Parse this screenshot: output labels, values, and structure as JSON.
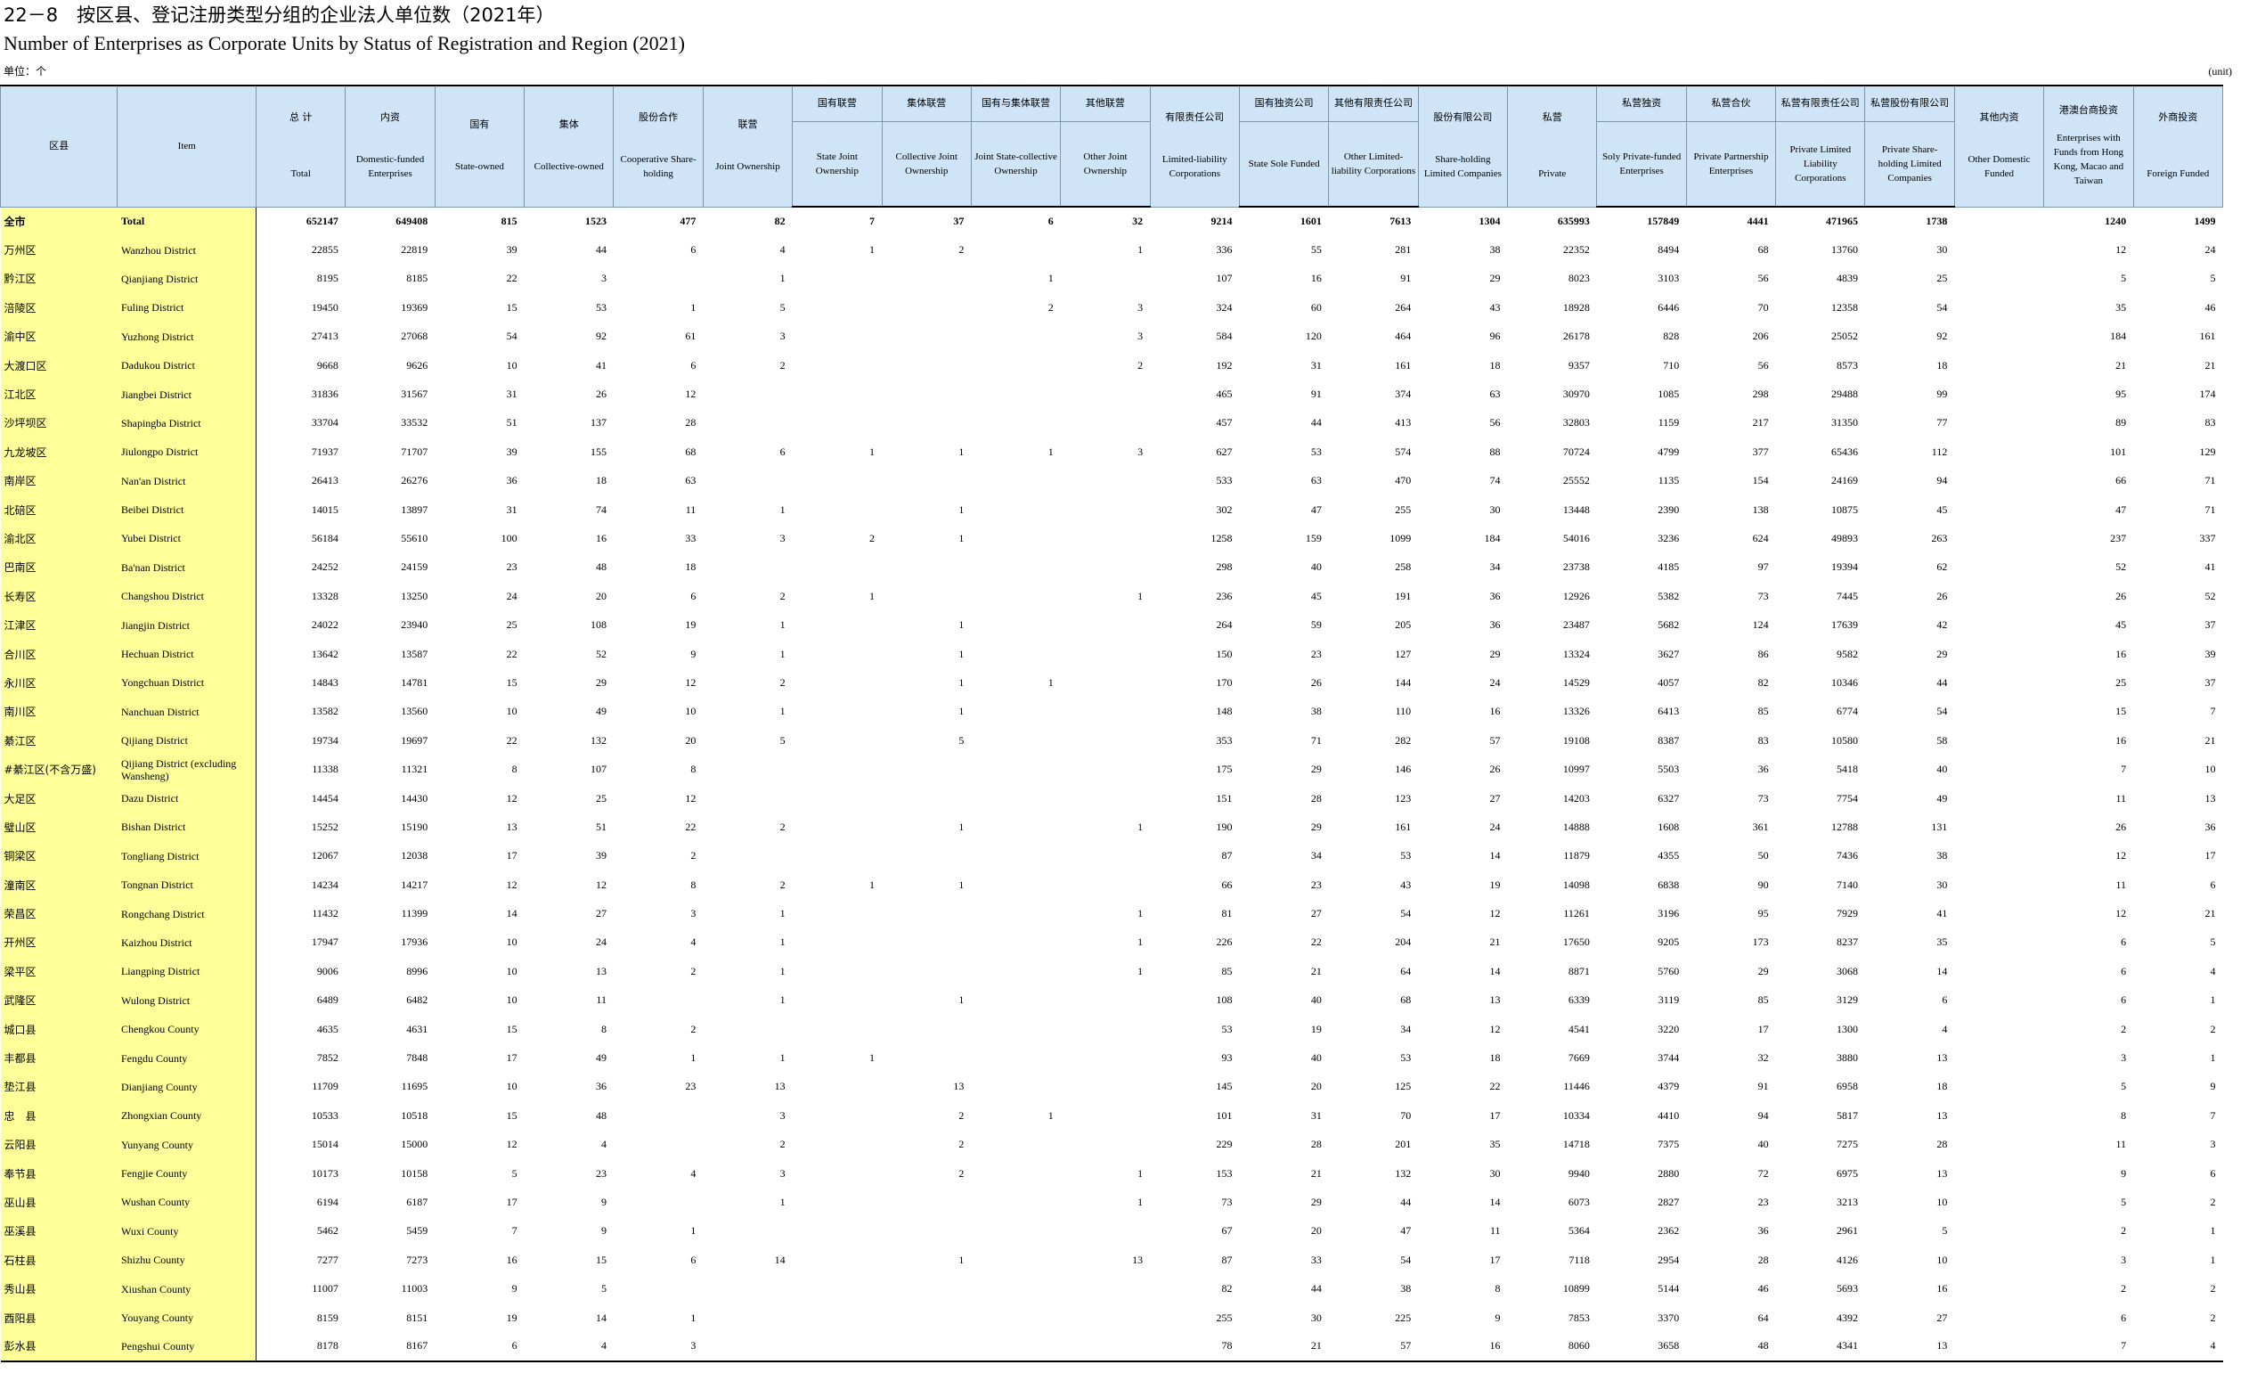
{
  "title_cn": "22－8　按区县、登记注册类型分组的企业法人单位数（2021年）",
  "title_en": "Number of Enterprises as Corporate Units by Status of Registration and Region (2021)",
  "unit_cn": "单位：个",
  "unit_en": "(unit)",
  "header": {
    "region": "区县",
    "item": "Item",
    "total_cn": "总  计",
    "total_en": "Total",
    "domestic_cn": "内资",
    "domestic_en": "Domestic-funded Enterprises",
    "state_cn": "国有",
    "state_en": "State-owned",
    "collective_cn": "集体",
    "collective_en": "Collective-owned",
    "coop_cn": "股份合作",
    "coop_en": "Cooperative Share-holding",
    "joint_cn": "联营",
    "joint_en": "Joint Ownership",
    "state_joint_cn": "国有联营",
    "state_joint_en": "State Joint Ownership",
    "coll_joint_cn": "集体联营",
    "coll_joint_en": "Collective Joint Ownership",
    "sc_joint_cn": "国有与集体联营",
    "sc_joint_en": "Joint State-collective Ownership",
    "other_joint_cn": "其他联营",
    "other_joint_en": "Other Joint Ownership",
    "ltd_cn": "有限责任公司",
    "ltd_en": "Limited-liability Corporations",
    "state_sole_cn": "国有独资公司",
    "state_sole_en": "State Sole Funded",
    "other_ltd_cn": "其他有限责任公司",
    "other_ltd_en": "Other Limited-liability Corporations",
    "share_cn": "股份有限公司",
    "share_en": "Share-holding Limited Companies",
    "private_cn": "私营",
    "private_en": "Private",
    "sole_private_cn": "私营独资",
    "sole_private_en": "Soly Private-funded Enterprises",
    "partner_cn": "私营合伙",
    "partner_en": "Private Partnership Enterprises",
    "private_ltd_cn": "私营有限责任公司",
    "private_ltd_en": "Private Limited Liability Corporations",
    "private_share_cn": "私营股份有限公司",
    "private_share_en": "Private Share-holding Limited Companies",
    "other_dom_cn": "其他内资",
    "other_dom_en": "Other Domestic Funded",
    "hmt_cn": "港澳台商投资",
    "hmt_en": "Enterprises with Funds from Hong Kong, Macao and Taiwan",
    "foreign_cn": "外商投资",
    "foreign_en": "Foreign Funded"
  },
  "rows": [
    {
      "cn": "全市",
      "en": "Total",
      "v": [
        "652147",
        "649408",
        "815",
        "1523",
        "477",
        "82",
        "7",
        "37",
        "6",
        "32",
        "9214",
        "1601",
        "7613",
        "1304",
        "635993",
        "157849",
        "4441",
        "471965",
        "1738",
        "",
        "1240",
        "1499"
      ]
    },
    {
      "cn": "万州区",
      "en": "Wanzhou District",
      "v": [
        "22855",
        "22819",
        "39",
        "44",
        "6",
        "4",
        "1",
        "2",
        "",
        "1",
        "336",
        "55",
        "281",
        "38",
        "22352",
        "8494",
        "68",
        "13760",
        "30",
        "",
        "12",
        "24"
      ]
    },
    {
      "cn": "黔江区",
      "en": "Qianjiang District",
      "v": [
        "8195",
        "8185",
        "22",
        "3",
        "",
        "1",
        "",
        "",
        "1",
        "",
        "107",
        "16",
        "91",
        "29",
        "8023",
        "3103",
        "56",
        "4839",
        "25",
        "",
        "5",
        "5"
      ]
    },
    {
      "cn": "涪陵区",
      "en": "Fuling District",
      "v": [
        "19450",
        "19369",
        "15",
        "53",
        "1",
        "5",
        "",
        "",
        "2",
        "3",
        "324",
        "60",
        "264",
        "43",
        "18928",
        "6446",
        "70",
        "12358",
        "54",
        "",
        "35",
        "46"
      ]
    },
    {
      "cn": "渝中区",
      "en": "Yuzhong District",
      "v": [
        "27413",
        "27068",
        "54",
        "92",
        "61",
        "3",
        "",
        "",
        "",
        "3",
        "584",
        "120",
        "464",
        "96",
        "26178",
        "828",
        "206",
        "25052",
        "92",
        "",
        "184",
        "161"
      ]
    },
    {
      "cn": "大渡口区",
      "en": "Dadukou District",
      "v": [
        "9668",
        "9626",
        "10",
        "41",
        "6",
        "2",
        "",
        "",
        "",
        "2",
        "192",
        "31",
        "161",
        "18",
        "9357",
        "710",
        "56",
        "8573",
        "18",
        "",
        "21",
        "21"
      ]
    },
    {
      "cn": "江北区",
      "en": "Jiangbei District",
      "v": [
        "31836",
        "31567",
        "31",
        "26",
        "12",
        "",
        "",
        "",
        "",
        "",
        "465",
        "91",
        "374",
        "63",
        "30970",
        "1085",
        "298",
        "29488",
        "99",
        "",
        "95",
        "174"
      ]
    },
    {
      "cn": "沙坪坝区",
      "en": "Shapingba District",
      "v": [
        "33704",
        "33532",
        "51",
        "137",
        "28",
        "",
        "",
        "",
        "",
        "",
        "457",
        "44",
        "413",
        "56",
        "32803",
        "1159",
        "217",
        "31350",
        "77",
        "",
        "89",
        "83"
      ]
    },
    {
      "cn": "九龙坡区",
      "en": "Jiulongpo District",
      "v": [
        "71937",
        "71707",
        "39",
        "155",
        "68",
        "6",
        "1",
        "1",
        "1",
        "3",
        "627",
        "53",
        "574",
        "88",
        "70724",
        "4799",
        "377",
        "65436",
        "112",
        "",
        "101",
        "129"
      ]
    },
    {
      "cn": "南岸区",
      "en": "Nan'an District",
      "v": [
        "26413",
        "26276",
        "36",
        "18",
        "63",
        "",
        "",
        "",
        "",
        "",
        "533",
        "63",
        "470",
        "74",
        "25552",
        "1135",
        "154",
        "24169",
        "94",
        "",
        "66",
        "71"
      ]
    },
    {
      "cn": "北碚区",
      "en": "Beibei District",
      "v": [
        "14015",
        "13897",
        "31",
        "74",
        "11",
        "1",
        "",
        "1",
        "",
        "",
        "302",
        "47",
        "255",
        "30",
        "13448",
        "2390",
        "138",
        "10875",
        "45",
        "",
        "47",
        "71"
      ]
    },
    {
      "cn": "渝北区",
      "en": "Yubei District",
      "v": [
        "56184",
        "55610",
        "100",
        "16",
        "33",
        "3",
        "2",
        "1",
        "",
        "",
        "1258",
        "159",
        "1099",
        "184",
        "54016",
        "3236",
        "624",
        "49893",
        "263",
        "",
        "237",
        "337"
      ]
    },
    {
      "cn": "巴南区",
      "en": "Ba'nan District",
      "v": [
        "24252",
        "24159",
        "23",
        "48",
        "18",
        "",
        "",
        "",
        "",
        "",
        "298",
        "40",
        "258",
        "34",
        "23738",
        "4185",
        "97",
        "19394",
        "62",
        "",
        "52",
        "41"
      ]
    },
    {
      "cn": "长寿区",
      "en": "Changshou District",
      "v": [
        "13328",
        "13250",
        "24",
        "20",
        "6",
        "2",
        "1",
        "",
        "",
        "1",
        "236",
        "45",
        "191",
        "36",
        "12926",
        "5382",
        "73",
        "7445",
        "26",
        "",
        "26",
        "52"
      ]
    },
    {
      "cn": "江津区",
      "en": "Jiangjin District",
      "v": [
        "24022",
        "23940",
        "25",
        "108",
        "19",
        "1",
        "",
        "1",
        "",
        "",
        "264",
        "59",
        "205",
        "36",
        "23487",
        "5682",
        "124",
        "17639",
        "42",
        "",
        "45",
        "37"
      ]
    },
    {
      "cn": "合川区",
      "en": "Hechuan District",
      "v": [
        "13642",
        "13587",
        "22",
        "52",
        "9",
        "1",
        "",
        "1",
        "",
        "",
        "150",
        "23",
        "127",
        "29",
        "13324",
        "3627",
        "86",
        "9582",
        "29",
        "",
        "16",
        "39"
      ]
    },
    {
      "cn": "永川区",
      "en": "Yongchuan District",
      "v": [
        "14843",
        "14781",
        "15",
        "29",
        "12",
        "2",
        "",
        "1",
        "1",
        "",
        "170",
        "26",
        "144",
        "24",
        "14529",
        "4057",
        "82",
        "10346",
        "44",
        "",
        "25",
        "37"
      ]
    },
    {
      "cn": "南川区",
      "en": "Nanchuan District",
      "v": [
        "13582",
        "13560",
        "10",
        "49",
        "10",
        "1",
        "",
        "1",
        "",
        "",
        "148",
        "38",
        "110",
        "16",
        "13326",
        "6413",
        "85",
        "6774",
        "54",
        "",
        "15",
        "7"
      ]
    },
    {
      "cn": "綦江区",
      "en": "Qijiang District",
      "v": [
        "19734",
        "19697",
        "22",
        "132",
        "20",
        "5",
        "",
        "5",
        "",
        "",
        "353",
        "71",
        "282",
        "57",
        "19108",
        "8387",
        "83",
        "10580",
        "58",
        "",
        "16",
        "21"
      ]
    },
    {
      "cn": "#綦江区(不含万盛)",
      "en": "Qijiang District (excluding Wansheng)",
      "v": [
        "11338",
        "11321",
        "8",
        "107",
        "8",
        "",
        "",
        "",
        "",
        "",
        "175",
        "29",
        "146",
        "26",
        "10997",
        "5503",
        "36",
        "5418",
        "40",
        "",
        "7",
        "10"
      ]
    },
    {
      "cn": "大足区",
      "en": "Dazu District",
      "v": [
        "14454",
        "14430",
        "12",
        "25",
        "12",
        "",
        "",
        "",
        "",
        "",
        "151",
        "28",
        "123",
        "27",
        "14203",
        "6327",
        "73",
        "7754",
        "49",
        "",
        "11",
        "13"
      ]
    },
    {
      "cn": "璧山区",
      "en": "Bishan District",
      "v": [
        "15252",
        "15190",
        "13",
        "51",
        "22",
        "2",
        "",
        "1",
        "",
        "1",
        "190",
        "29",
        "161",
        "24",
        "14888",
        "1608",
        "361",
        "12788",
        "131",
        "",
        "26",
        "36"
      ]
    },
    {
      "cn": "铜梁区",
      "en": "Tongliang District",
      "v": [
        "12067",
        "12038",
        "17",
        "39",
        "2",
        "",
        "",
        "",
        "",
        "",
        "87",
        "34",
        "53",
        "14",
        "11879",
        "4355",
        "50",
        "7436",
        "38",
        "",
        "12",
        "17"
      ]
    },
    {
      "cn": "潼南区",
      "en": "Tongnan District",
      "v": [
        "14234",
        "14217",
        "12",
        "12",
        "8",
        "2",
        "1",
        "1",
        "",
        "",
        "66",
        "23",
        "43",
        "19",
        "14098",
        "6838",
        "90",
        "7140",
        "30",
        "",
        "11",
        "6"
      ]
    },
    {
      "cn": "荣昌区",
      "en": "Rongchang District",
      "v": [
        "11432",
        "11399",
        "14",
        "27",
        "3",
        "1",
        "",
        "",
        "",
        "1",
        "81",
        "27",
        "54",
        "12",
        "11261",
        "3196",
        "95",
        "7929",
        "41",
        "",
        "12",
        "21"
      ]
    },
    {
      "cn": "开州区",
      "en": "Kaizhou District",
      "v": [
        "17947",
        "17936",
        "10",
        "24",
        "4",
        "1",
        "",
        "",
        "",
        "1",
        "226",
        "22",
        "204",
        "21",
        "17650",
        "9205",
        "173",
        "8237",
        "35",
        "",
        "6",
        "5"
      ]
    },
    {
      "cn": "梁平区",
      "en": "Liangping District",
      "v": [
        "9006",
        "8996",
        "10",
        "13",
        "2",
        "1",
        "",
        "",
        "",
        "1",
        "85",
        "21",
        "64",
        "14",
        "8871",
        "5760",
        "29",
        "3068",
        "14",
        "",
        "6",
        "4"
      ]
    },
    {
      "cn": "武隆区",
      "en": "Wulong District",
      "v": [
        "6489",
        "6482",
        "10",
        "11",
        "",
        "1",
        "",
        "1",
        "",
        "",
        "108",
        "40",
        "68",
        "13",
        "6339",
        "3119",
        "85",
        "3129",
        "6",
        "",
        "6",
        "1"
      ]
    },
    {
      "cn": "城口县",
      "en": "Chengkou County",
      "v": [
        "4635",
        "4631",
        "15",
        "8",
        "2",
        "",
        "",
        "",
        "",
        "",
        "53",
        "19",
        "34",
        "12",
        "4541",
        "3220",
        "17",
        "1300",
        "4",
        "",
        "2",
        "2"
      ]
    },
    {
      "cn": "丰都县",
      "en": "Fengdu County",
      "v": [
        "7852",
        "7848",
        "17",
        "49",
        "1",
        "1",
        "1",
        "",
        "",
        "",
        "93",
        "40",
        "53",
        "18",
        "7669",
        "3744",
        "32",
        "3880",
        "13",
        "",
        "3",
        "1"
      ]
    },
    {
      "cn": "垫江县",
      "en": "Dianjiang County",
      "v": [
        "11709",
        "11695",
        "10",
        "36",
        "23",
        "13",
        "",
        "13",
        "",
        "",
        "145",
        "20",
        "125",
        "22",
        "11446",
        "4379",
        "91",
        "6958",
        "18",
        "",
        "5",
        "9"
      ]
    },
    {
      "cn": "忠　县",
      "en": "Zhongxian County",
      "v": [
        "10533",
        "10518",
        "15",
        "48",
        "",
        "3",
        "",
        "2",
        "1",
        "",
        "101",
        "31",
        "70",
        "17",
        "10334",
        "4410",
        "94",
        "5817",
        "13",
        "",
        "8",
        "7"
      ]
    },
    {
      "cn": "云阳县",
      "en": "Yunyang County",
      "v": [
        "15014",
        "15000",
        "12",
        "4",
        "",
        "2",
        "",
        "2",
        "",
        "",
        "229",
        "28",
        "201",
        "35",
        "14718",
        "7375",
        "40",
        "7275",
        "28",
        "",
        "11",
        "3"
      ]
    },
    {
      "cn": "奉节县",
      "en": "Fengjie County",
      "v": [
        "10173",
        "10158",
        "5",
        "23",
        "4",
        "3",
        "",
        "2",
        "",
        "1",
        "153",
        "21",
        "132",
        "30",
        "9940",
        "2880",
        "72",
        "6975",
        "13",
        "",
        "9",
        "6"
      ]
    },
    {
      "cn": "巫山县",
      "en": "Wushan County",
      "v": [
        "6194",
        "6187",
        "17",
        "9",
        "",
        "1",
        "",
        "",
        "",
        "1",
        "73",
        "29",
        "44",
        "14",
        "6073",
        "2827",
        "23",
        "3213",
        "10",
        "",
        "5",
        "2"
      ]
    },
    {
      "cn": "巫溪县",
      "en": "Wuxi County",
      "v": [
        "5462",
        "5459",
        "7",
        "9",
        "1",
        "",
        "",
        "",
        "",
        "",
        "67",
        "20",
        "47",
        "11",
        "5364",
        "2362",
        "36",
        "2961",
        "5",
        "",
        "2",
        "1"
      ]
    },
    {
      "cn": "石柱县",
      "en": "Shizhu County",
      "v": [
        "7277",
        "7273",
        "16",
        "15",
        "6",
        "14",
        "",
        "1",
        "",
        "13",
        "87",
        "33",
        "54",
        "17",
        "7118",
        "2954",
        "28",
        "4126",
        "10",
        "",
        "3",
        "1"
      ]
    },
    {
      "cn": "秀山县",
      "en": "Xiushan County",
      "v": [
        "11007",
        "11003",
        "9",
        "5",
        "",
        "",
        "",
        "",
        "",
        "",
        "82",
        "44",
        "38",
        "8",
        "10899",
        "5144",
        "46",
        "5693",
        "16",
        "",
        "2",
        "2"
      ]
    },
    {
      "cn": "酉阳县",
      "en": "Youyang County",
      "v": [
        "8159",
        "8151",
        "19",
        "14",
        "1",
        "",
        "",
        "",
        "",
        "",
        "255",
        "30",
        "225",
        "9",
        "7853",
        "3370",
        "64",
        "4392",
        "27",
        "",
        "6",
        "2"
      ]
    },
    {
      "cn": "彭水县",
      "en": "Pengshui County",
      "v": [
        "8178",
        "8167",
        "6",
        "4",
        "3",
        "",
        "",
        "",
        "",
        "",
        "78",
        "21",
        "57",
        "16",
        "8060",
        "3658",
        "48",
        "4341",
        "13",
        "",
        "7",
        "4"
      ]
    }
  ]
}
